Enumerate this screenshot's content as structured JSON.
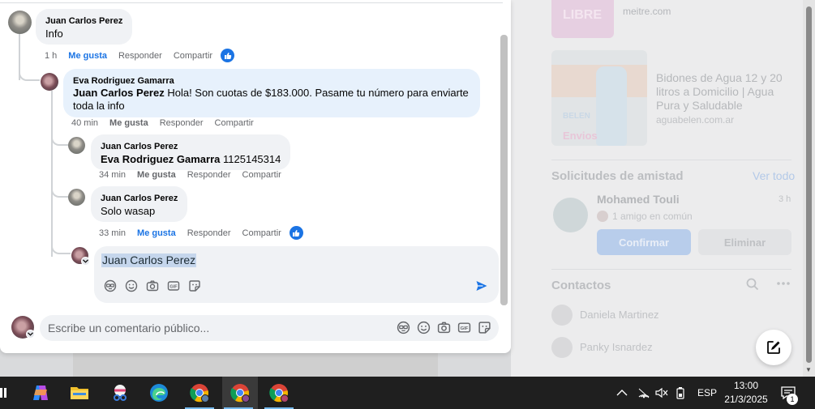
{
  "comments": [
    {
      "author": "Juan Carlos Perez",
      "mention": "",
      "text": "Info",
      "time": "1 h",
      "like": "Me gusta",
      "reply": "Responder",
      "share": "Compartir"
    },
    {
      "author": "Eva Rodriguez Gamarra",
      "mention": "Juan Carlos Perez",
      "text": " Hola! Son cuotas de $183.000. Pasame tu número para enviarte toda la info",
      "time": "40 min",
      "like": "Me gusta",
      "reply": "Responder",
      "share": "Compartir"
    },
    {
      "author": "Juan Carlos Perez",
      "mention": "Eva Rodriguez Gamarra",
      "text": " 1125145314",
      "time": "34 min",
      "like": "Me gusta",
      "reply": "Responder",
      "share": "Compartir"
    },
    {
      "author": "Juan Carlos Perez",
      "mention": "",
      "text": "Solo wasap",
      "time": "33 min",
      "like": "Me gusta",
      "reply": "Responder",
      "share": "Compartir"
    }
  ],
  "reply_box": {
    "value": "Juan Carlos Perez"
  },
  "main_input": {
    "placeholder": "Escribe un comentario público..."
  },
  "sidebar": {
    "ad1": {
      "image_text": "LIBRE",
      "domain": "meitre.com"
    },
    "ad2": {
      "image_logo": "BELEN",
      "image_text": "Envios",
      "title": "Bidones de Agua 12 y 20 litros a Domicilio | Agua Pura y Saludable",
      "domain": "aguabelen.com.ar"
    },
    "friend_requests": {
      "title": "Solicitudes de amistad",
      "see_all": "Ver todo",
      "name": "Mohamed Touli",
      "time": "3 h",
      "mutual": "1 amigo en común",
      "confirm": "Confirmar",
      "delete": "Eliminar"
    },
    "contacts": {
      "title": "Contactos",
      "items": [
        "Daniela Martinez",
        "Panky Isnardez"
      ]
    }
  },
  "taskbar": {
    "language": "ESP",
    "time": "13:00",
    "date": "21/3/2025",
    "notifications": "1"
  },
  "colors": {
    "accent": "#1b74e4",
    "bubble": "#f0f2f5",
    "bubble_highlight": "#e7f1fc",
    "taskbar": "#1f1f1f"
  }
}
